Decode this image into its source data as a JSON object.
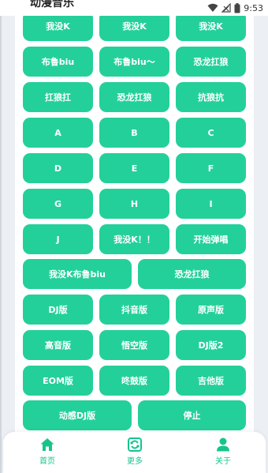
{
  "status_bar": {
    "title": "动漫音乐",
    "time": "9:53"
  },
  "buttons": [
    {
      "label": "我没K"
    },
    {
      "label": "我没K"
    },
    {
      "label": "我没K"
    },
    {
      "label": "布鲁biu"
    },
    {
      "label": "布鲁biu～"
    },
    {
      "label": "恐龙扛狼"
    },
    {
      "label": "扛狼扛"
    },
    {
      "label": "恐龙扛狼"
    },
    {
      "label": "抗狼抗"
    },
    {
      "label": "A"
    },
    {
      "label": "B"
    },
    {
      "label": "C"
    },
    {
      "label": "D"
    },
    {
      "label": "E"
    },
    {
      "label": "F"
    },
    {
      "label": "G"
    },
    {
      "label": "H"
    },
    {
      "label": "I"
    },
    {
      "label": "J"
    },
    {
      "label": "我没K！！"
    },
    {
      "label": "开始弹唱"
    },
    {
      "label": "我没K布鲁biu"
    },
    {
      "label": "恐龙扛狼"
    },
    {
      "label": "DJ版"
    },
    {
      "label": "抖音版"
    },
    {
      "label": "原声版"
    },
    {
      "label": "高音版"
    },
    {
      "label": "悟空版"
    },
    {
      "label": "DJ版2"
    },
    {
      "label": "EOM版"
    },
    {
      "label": "咚鼓版"
    },
    {
      "label": "吉他版"
    },
    {
      "label": "动感DJ版"
    },
    {
      "label": "停止"
    }
  ],
  "bottom_nav": {
    "items": [
      {
        "label": "首页",
        "icon": "home-icon"
      },
      {
        "label": "更多",
        "icon": "more-icon"
      },
      {
        "label": "关于",
        "icon": "user-icon"
      }
    ],
    "active_color": "#17c48c"
  },
  "colors": {
    "button": "#24d09a",
    "background": "#eceff3"
  }
}
